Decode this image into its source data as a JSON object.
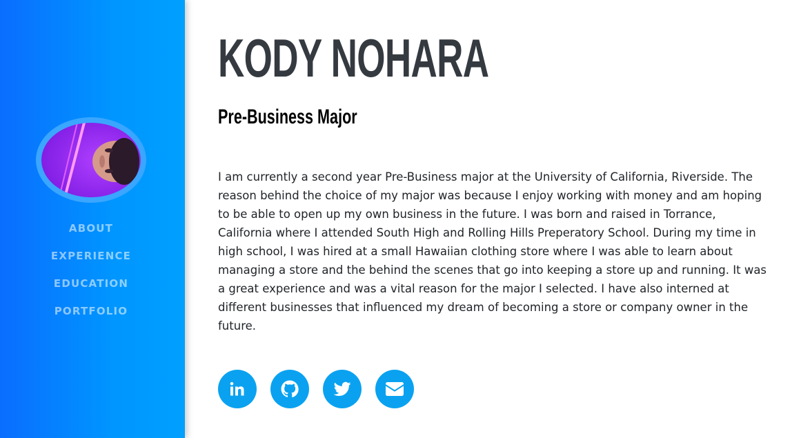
{
  "profile": {
    "name": "KODY NOHARA",
    "subtitle": "Pre-Business Major",
    "bio": "I am currently a second year Pre-Business major at the University of California, Riverside. The reason behind the choice of my major was because I enjoy working with money and am hoping to be able to open up my own business in the future. I was born and raised in Torrance, California where I attended South High and Rolling Hills Preperatory School. During my time in high school, I was hired at a small Hawaiian clothing store where I was able to learn about managing a store and the behind the scenes that go into keeping a store up and running. It was a great experience and was a vital reason for the major I selected. I have also interned at different businesses that influenced my dream of becoming a store or company owner in the future."
  },
  "sidebar": {
    "nav": [
      {
        "label": "ABOUT"
      },
      {
        "label": "EXPERIENCE"
      },
      {
        "label": "EDUCATION"
      },
      {
        "label": "PORTFOLIO"
      }
    ]
  },
  "social": [
    {
      "icon": "linkedin-icon"
    },
    {
      "icon": "github-icon"
    },
    {
      "icon": "twitter-icon"
    },
    {
      "icon": "envelope-icon"
    }
  ],
  "colors": {
    "sidebar_start": "#0a6dff",
    "sidebar_end": "#00a0ff",
    "social_button": "#0aa2f0",
    "name_text": "#343a40"
  }
}
